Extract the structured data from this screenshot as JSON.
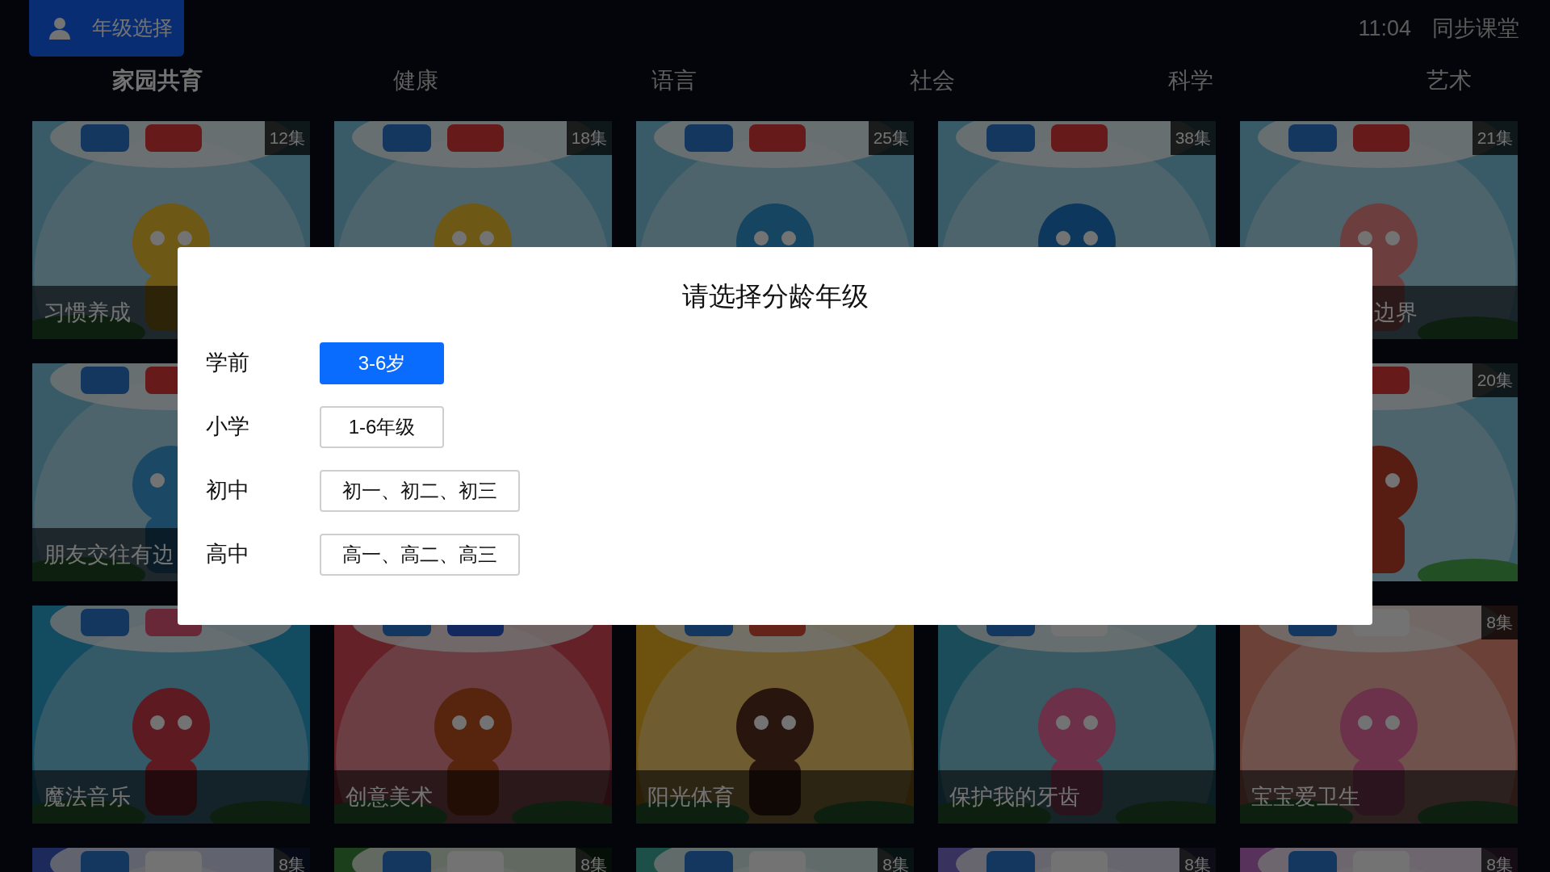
{
  "top_bar": {
    "grade_button": "年级选择",
    "time": "11:04",
    "app_name": "同步课堂"
  },
  "tabs": [
    {
      "label": "家园共育",
      "selected": true
    },
    {
      "label": "健康",
      "selected": false
    },
    {
      "label": "语言",
      "selected": false
    },
    {
      "label": "社会",
      "selected": false
    },
    {
      "label": "科学",
      "selected": false
    },
    {
      "label": "艺术",
      "selected": false
    }
  ],
  "card_rows": [
    [
      {
        "kind": "card",
        "count": "12集",
        "title": "习惯养成"
      },
      {
        "kind": "card",
        "count": "18集"
      },
      {
        "kind": "card",
        "count": "25集"
      },
      {
        "kind": "card",
        "count": "38集"
      },
      {
        "kind": "card",
        "count": "21集",
        "title": "边界"
      }
    ],
    [
      {
        "kind": "card",
        "title": "朋友交往有边"
      },
      {
        "kind": "covered"
      },
      {
        "kind": "covered"
      },
      {
        "kind": "covered"
      },
      {
        "kind": "card",
        "count": "20集"
      }
    ],
    [
      {
        "kind": "card",
        "title": "魔法音乐"
      },
      {
        "kind": "card",
        "title": "创意美术"
      },
      {
        "kind": "card",
        "title": "阳光体育"
      },
      {
        "kind": "card",
        "title": "保护我的牙齿"
      },
      {
        "kind": "card",
        "count": "8集",
        "title": "宝宝爱卫生"
      }
    ],
    [
      {
        "kind": "card",
        "count": "8集"
      },
      {
        "kind": "card",
        "count": "8集"
      },
      {
        "kind": "card",
        "count": "8集"
      },
      {
        "kind": "card",
        "count": "8集"
      },
      {
        "kind": "card",
        "count": "8集"
      }
    ]
  ],
  "dialog": {
    "title": "请选择分龄年级",
    "groups": [
      {
        "label": "学前",
        "options": [
          {
            "label": "3-6岁",
            "selected": true
          }
        ]
      },
      {
        "label": "小学",
        "options": [
          {
            "label": "1-6年级",
            "selected": false
          }
        ]
      },
      {
        "label": "初中",
        "options": [
          {
            "label": "初一、初二、初三",
            "selected": false
          }
        ]
      },
      {
        "label": "高中",
        "options": [
          {
            "label": "高一、高二、高三",
            "selected": false
          }
        ]
      }
    ]
  }
}
